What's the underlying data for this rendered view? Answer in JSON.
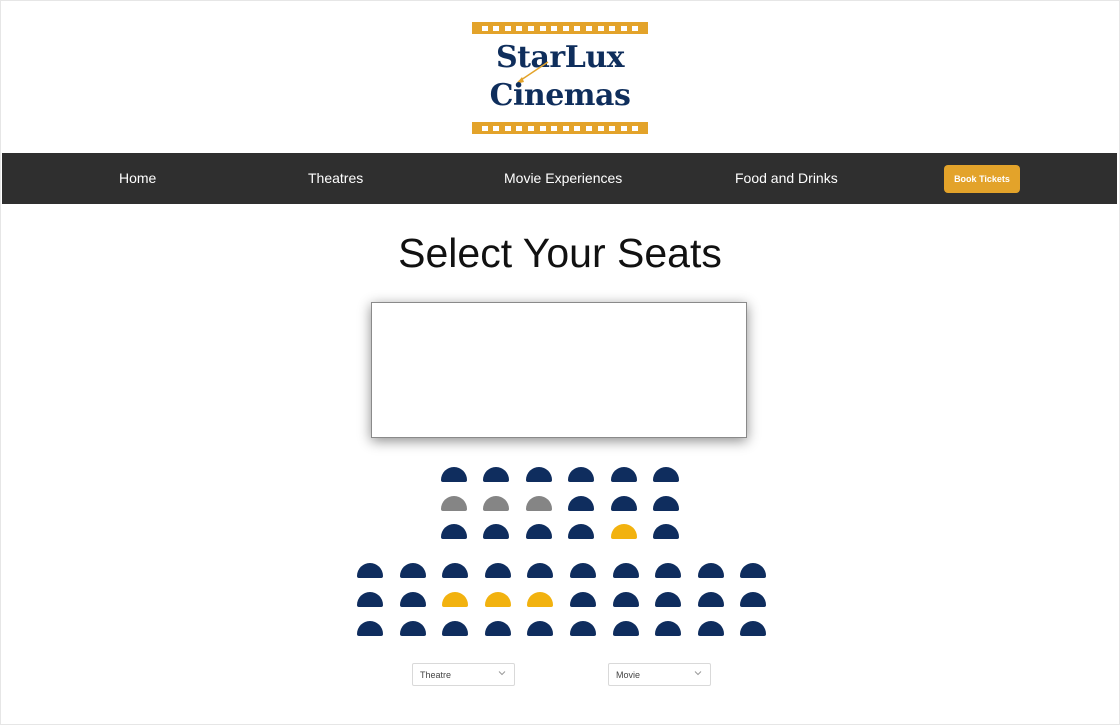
{
  "logo": {
    "line1": "StarLux",
    "line2": "Cinemas",
    "strip_color": "#e3a32a",
    "text_color": "#0f2e5c"
  },
  "nav": {
    "items": [
      {
        "label": "Home"
      },
      {
        "label": "Theatres"
      },
      {
        "label": "Movie Experiences"
      },
      {
        "label": "Food and Drinks"
      }
    ],
    "book_button": "Book Tickets",
    "background": "#2f2f2f",
    "accent": "#e3a32a"
  },
  "page": {
    "title": "Select Your Seats"
  },
  "seating": {
    "colors": {
      "available": "#0f2d5e",
      "taken": "#858585",
      "selected": "#f2b20f"
    },
    "upper_block": [
      [
        "available",
        "available",
        "available",
        "available",
        "available",
        "available"
      ],
      [
        "taken",
        "taken",
        "taken",
        "available",
        "available",
        "available"
      ],
      [
        "available",
        "available",
        "available",
        "available",
        "selected",
        "available"
      ]
    ],
    "lower_block": [
      [
        "available",
        "available",
        "available",
        "available",
        "available",
        "available",
        "available",
        "available",
        "available",
        "available"
      ],
      [
        "available",
        "available",
        "selected",
        "selected",
        "selected",
        "available",
        "available",
        "available",
        "available",
        "available"
      ],
      [
        "available",
        "available",
        "available",
        "available",
        "available",
        "available",
        "available",
        "available",
        "available",
        "available"
      ]
    ]
  },
  "filters": {
    "theatre": {
      "value": "Theatre"
    },
    "movie": {
      "value": "Movie"
    }
  }
}
